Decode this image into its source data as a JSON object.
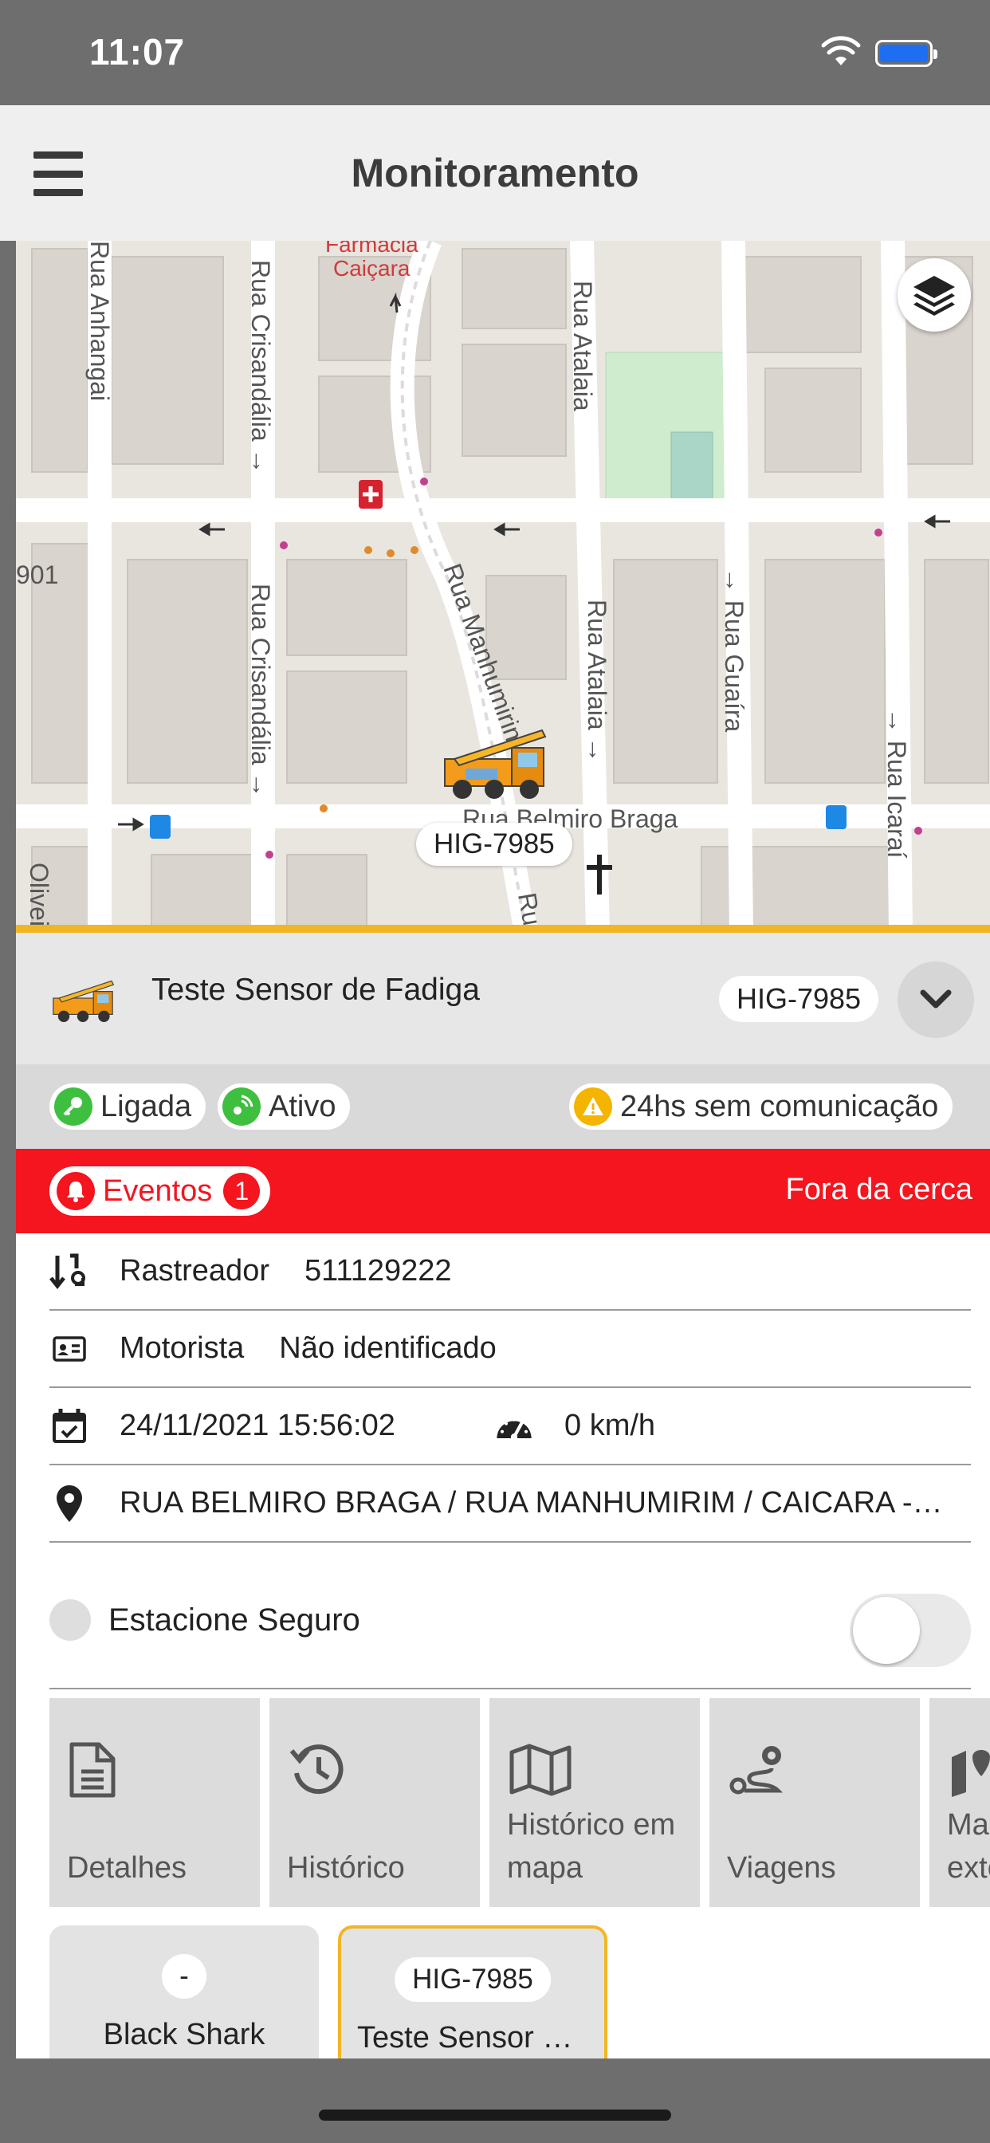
{
  "status_bar": {
    "time": "11:07"
  },
  "header": {
    "title": "Monitoramento",
    "menu_icon": "hamburger-menu-icon"
  },
  "map": {
    "labels": {
      "pharmacy_line1": "Farmácia",
      "pharmacy_line2": "Caiçara",
      "rua_anhangai": "Rua Anhangai",
      "rua_crisandalia_top": "Rua Crisandália →",
      "rua_crisandalia_bottom": "Rua Crisandália →",
      "rua_atalaia_top": "Rua Atalaia",
      "rua_atalaia_bottom": "Rua Atalaia →",
      "rua_manhumirim": "Rua Manhumirim",
      "rua_guaira": "→ Rua Guaíra",
      "rua_icarai": "→ Rua Icaraí",
      "rua_belmiro": "Rua Belmiro Braga",
      "house_number": "901",
      "oliveira": "Oliveira",
      "ru": "Ru"
    },
    "marker_plate": "HIG-7985",
    "layers_icon": "layers-icon"
  },
  "vehicle": {
    "name": "Teste Sensor de Fadiga",
    "plate": "HIG-7985"
  },
  "status": {
    "ignition": "Ligada",
    "active": "Ativo",
    "warning": "24hs sem comunicação"
  },
  "events": {
    "label": "Eventos",
    "count": "1",
    "status": "Fora da cerca"
  },
  "details": {
    "tracker_label": "Rastreador",
    "tracker_value": "511129222",
    "driver_label": "Motorista",
    "driver_value": "Não identificado",
    "datetime": "24/11/2021 15:56:02",
    "speed": "0 km/h",
    "address": "RUA BELMIRO BRAGA / RUA MANHUMIRIM / CAICARA - BELO HORIZONTE"
  },
  "safe_parking": {
    "label": "Estacione Seguro",
    "enabled": false
  },
  "actions": [
    {
      "label": "Detalhes",
      "icon": "document-icon"
    },
    {
      "label": "Histórico",
      "icon": "history-icon"
    },
    {
      "label": "Histórico em mapa",
      "icon": "map-icon"
    },
    {
      "label": "Viagens",
      "icon": "route-icon"
    },
    {
      "label": "Mapa externo",
      "icon": "map-pin-icon"
    }
  ],
  "fleet": [
    {
      "plate": "-",
      "name": "Black Shark"
    },
    {
      "plate": "HIG-7985",
      "name": "Teste Sensor de Fadiga"
    }
  ],
  "colors": {
    "accent": "#f2b624",
    "alert": "#f4151f",
    "header_bg": "#efefef",
    "ignition_green": "#3fbf3f",
    "warning_yellow": "#f4b400"
  }
}
